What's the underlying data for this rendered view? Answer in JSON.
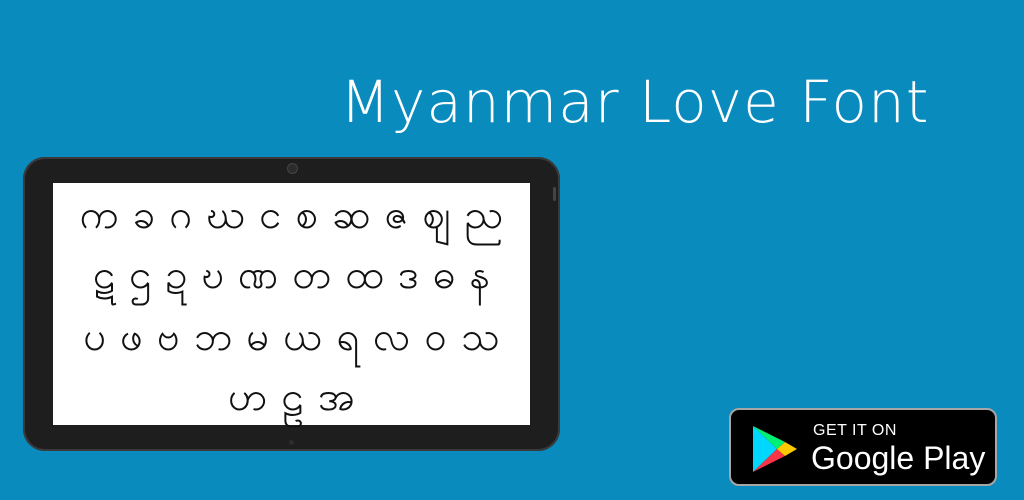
{
  "header": {
    "title": "Myanmar Love Font"
  },
  "tablet": {
    "rows": [
      [
        "က",
        "ခ",
        "ဂ",
        "ဃ",
        "င",
        "စ",
        "ဆ",
        "ဇ",
        "ဈ",
        "ည"
      ],
      [
        "ဋ",
        "ဌ",
        "ဍ",
        "ဎ",
        "ဏ",
        "တ",
        "ထ",
        "ဒ",
        "ဓ",
        "န"
      ],
      [
        "ပ",
        "ဖ",
        "ဗ",
        "ဘ",
        "မ",
        "ယ",
        "ရ",
        "လ",
        "ဝ",
        "သ"
      ],
      [
        "ဟ",
        "ဠ",
        "အ"
      ]
    ]
  },
  "badge": {
    "line1": "GET IT ON",
    "line2": "Google Play"
  },
  "colors": {
    "background": "#0a8bbd",
    "tablet": "#1e1e1e",
    "screen": "#ffffff"
  },
  "icons": {
    "store": "google-play-icon"
  }
}
